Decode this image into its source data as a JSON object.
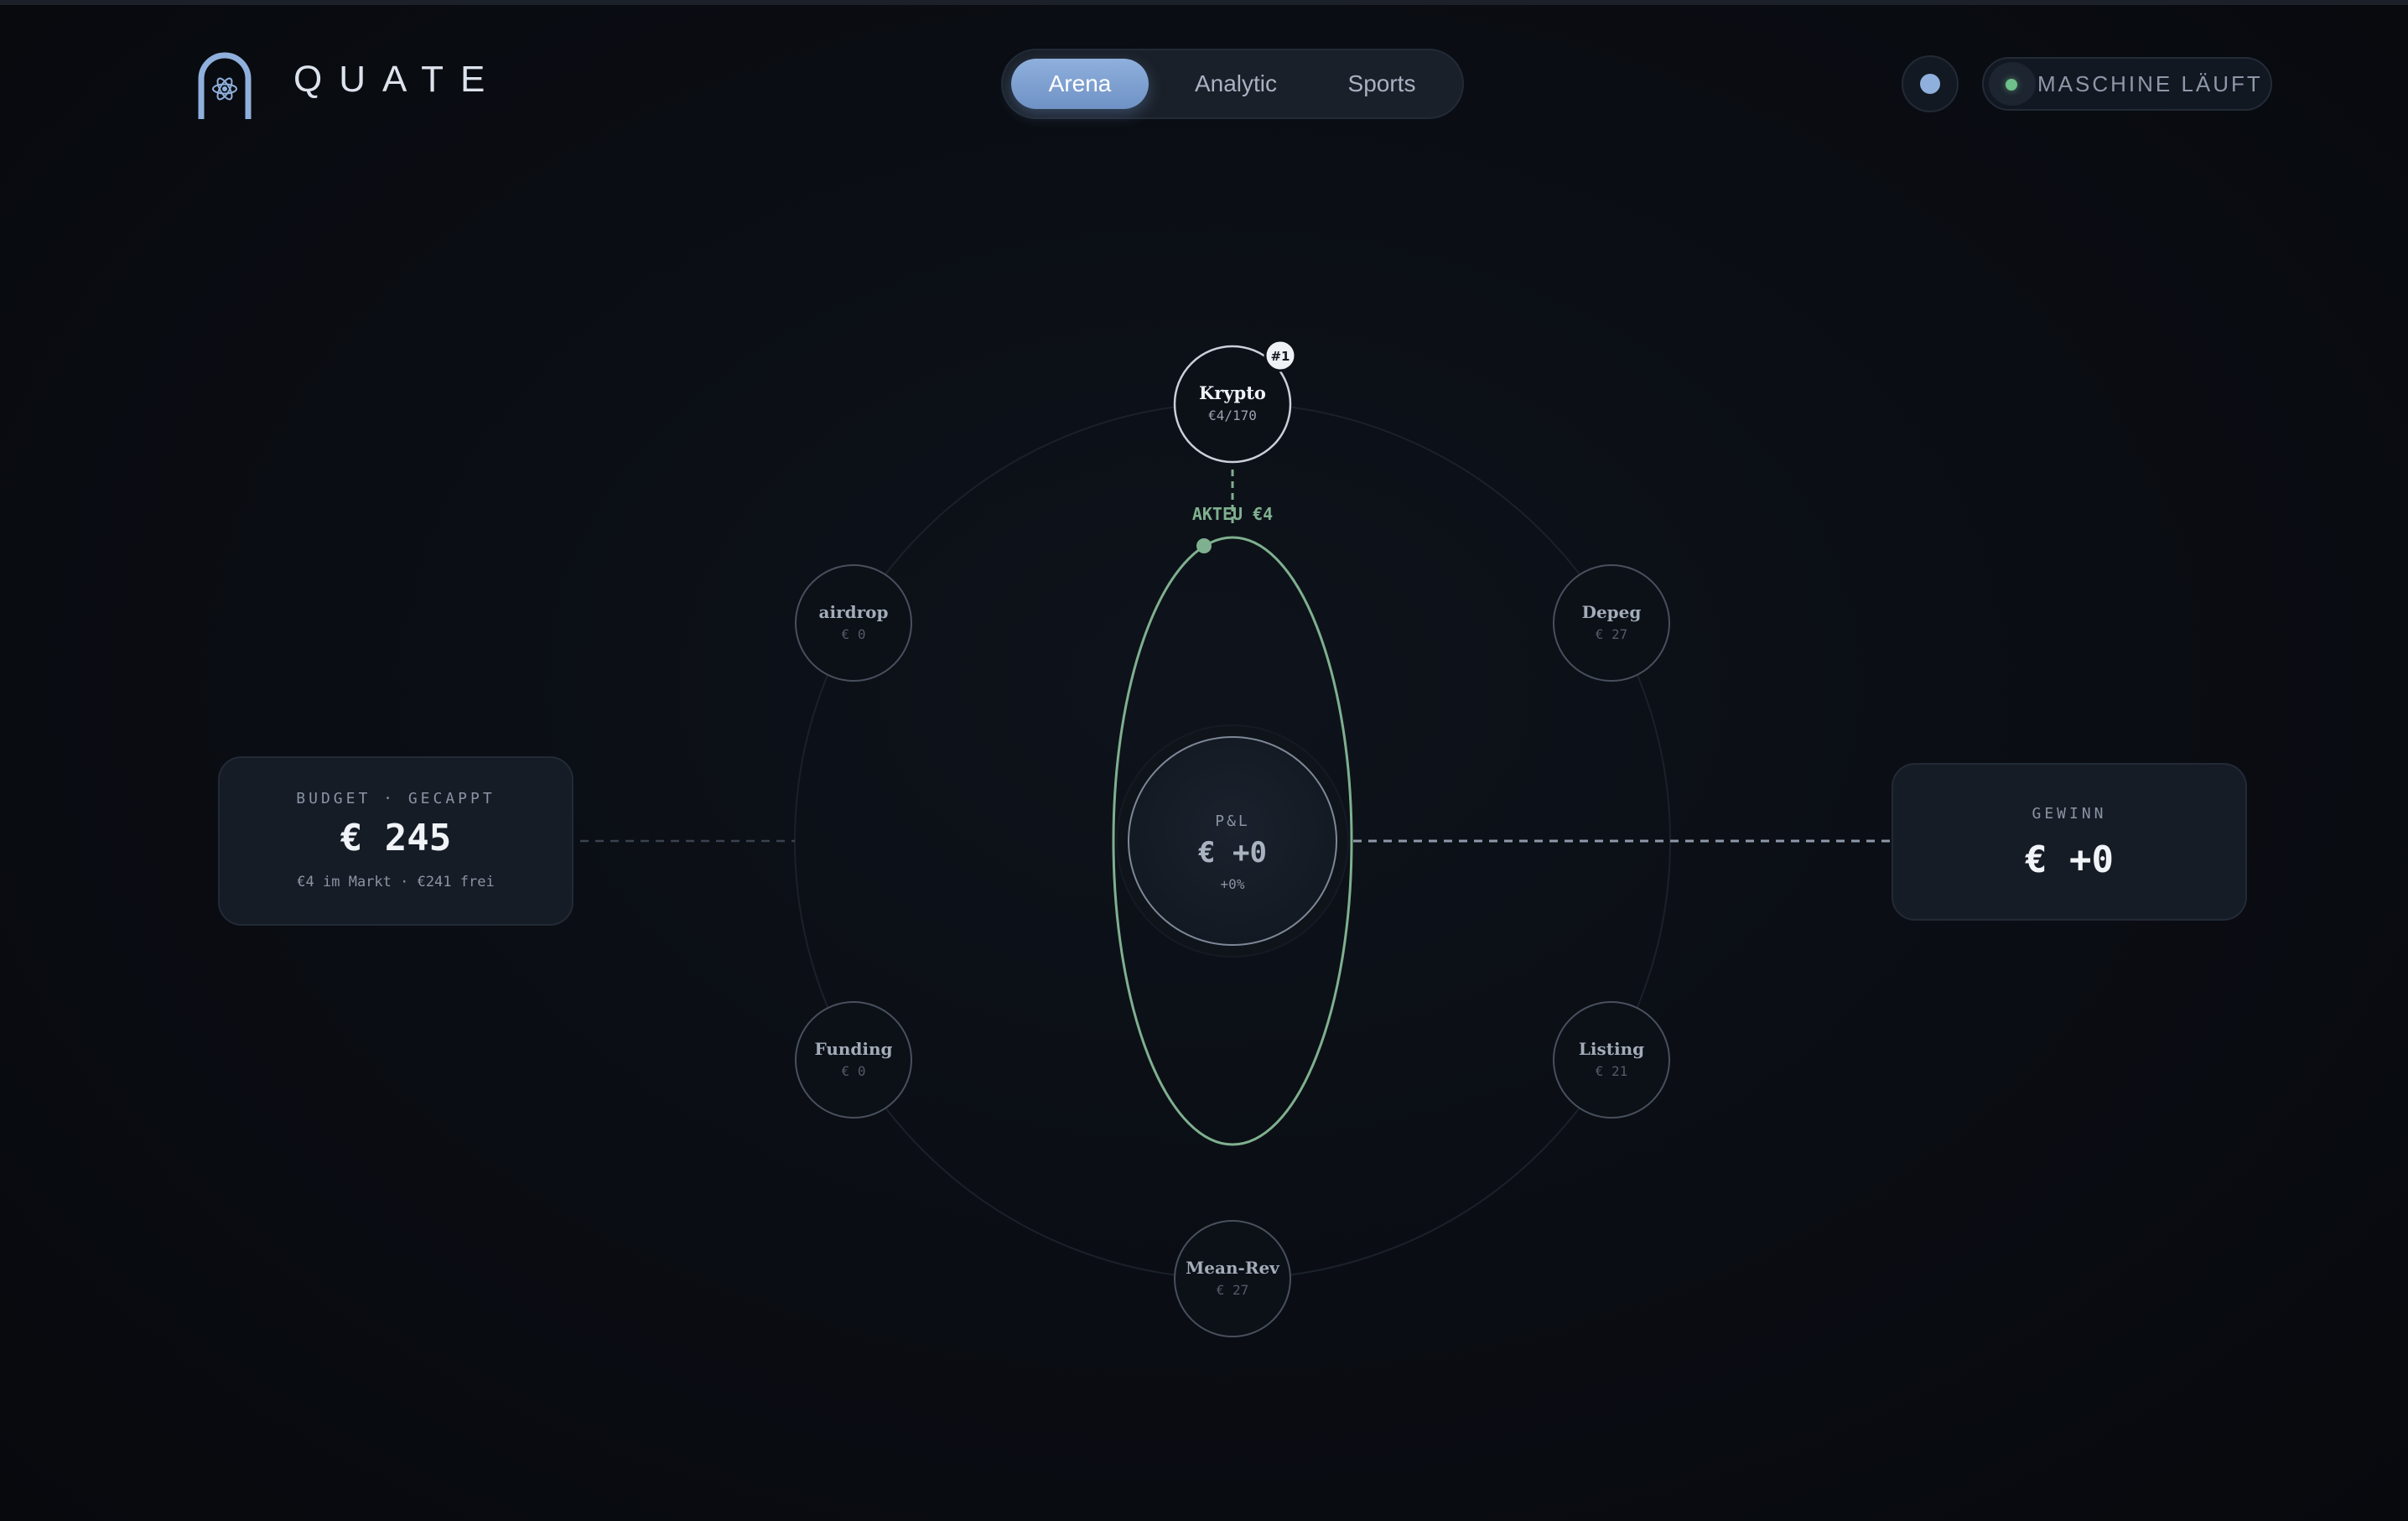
{
  "header": {
    "brand": "QUATE",
    "tabs": [
      {
        "label": "Arena",
        "active": true
      },
      {
        "label": "Analytic",
        "active": false
      },
      {
        "label": "Sports",
        "active": false
      }
    ],
    "status": "MASCHINE LÄUFT"
  },
  "budget": {
    "caption": "BUDGET · GECAPPT",
    "amount": "€ 245",
    "detail": "€4 im Markt · €241 frei"
  },
  "gain": {
    "caption": "GEWINN",
    "amount": "€ +0"
  },
  "center": {
    "caption": "P&L",
    "amount": "€ +0",
    "percent": "+0%"
  },
  "active_label": "AKTEU €4",
  "nodes": {
    "krypto": {
      "name": "Krypto",
      "value": "€4/170",
      "rank": "#1"
    },
    "airdrop": {
      "name": "airdrop",
      "value": "€ 0"
    },
    "depeg": {
      "name": "Depeg",
      "value": "€ 27"
    },
    "funding": {
      "name": "Funding",
      "value": "€ 0"
    },
    "listing": {
      "name": "Listing",
      "value": "€ 21"
    },
    "meanrev": {
      "name": "Mean-Rev",
      "value": "€ 27"
    }
  },
  "colors": {
    "accent": "#8fb0dc",
    "active_green": "#7fb08f",
    "status_green": "#6fc08a"
  }
}
